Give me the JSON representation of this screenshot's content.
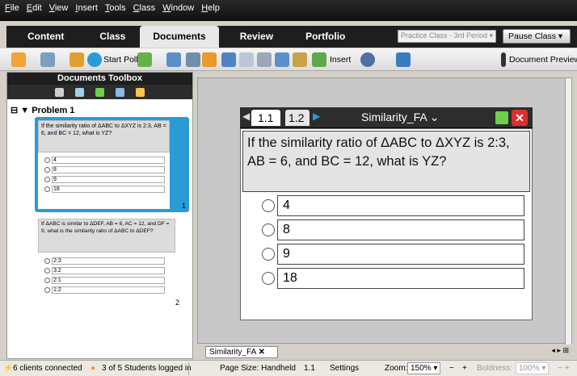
{
  "menu": [
    "File",
    "Edit",
    "View",
    "Insert",
    "Tools",
    "Class",
    "Window",
    "Help"
  ],
  "tabs": [
    "Content",
    "Class",
    "Documents",
    "Review",
    "Portfolio"
  ],
  "active_tab": "Documents",
  "class_select": "Practice Class - 3rd Period",
  "pause_button": "Pause Class",
  "toolbar": {
    "start_poll": "Start Poll",
    "insert": "Insert",
    "document_preview": "Document Preview"
  },
  "sidebar": {
    "title": "Documents Toolbox",
    "problem_label": "Problem 1",
    "page1": {
      "number": "1",
      "question": "If the similarity ratio of ΔABC to ΔXYZ is 2:3, AB = 6, and BC = 12, what is YZ?",
      "options": [
        "4",
        "8",
        "9",
        "18"
      ]
    },
    "page2": {
      "number": "2",
      "question": "If ΔABC is similar to ΔDEF, AB = 6, AC = 12, and DF = 9, what is the similarity ratio of ΔABC to ΔDEF?",
      "options": [
        "2:3",
        "3:2",
        "2:1",
        "1:2"
      ]
    }
  },
  "document": {
    "tab1": "1.1",
    "tab2": "1.2",
    "title": "Similarity_FA",
    "question": "If the similarity ratio of ΔABC to ΔXYZ is 2:3, AB = 6, and BC = 12, what is YZ?",
    "options": [
      "4",
      "8",
      "9",
      "18"
    ]
  },
  "doc_tab_label": "Similarity_FA",
  "status": {
    "clients": "6 clients connected",
    "students": "3 of 5 Students logged in",
    "page_size": "Page Size: Handheld",
    "page_num": "1.1",
    "settings": "Settings",
    "zoom_label": "Zoom:",
    "zoom_value": "150%",
    "boldness_label": "Boldness:",
    "boldness_value": "100%"
  },
  "colors": {
    "accent_blue": "#2a9bd6",
    "menubar": "#111111",
    "question_bg": "#e4e4e4"
  }
}
